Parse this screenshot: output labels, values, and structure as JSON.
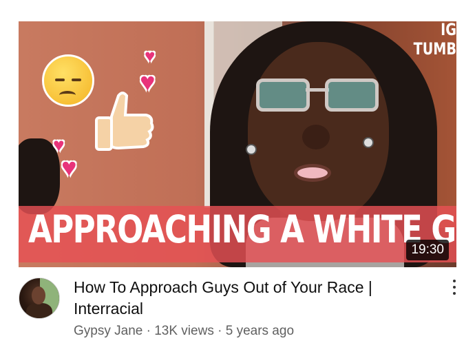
{
  "video": {
    "thumbnail_text": "APPROACHING A WHITE GUY",
    "watermark_line1": "IG",
    "watermark_line2": "TUMB",
    "duration": "19:30",
    "title": "How To Approach Guys Out of Your Race | Interracial",
    "channel": "Gypsy Jane",
    "views": "13K views",
    "age": "5 years ago",
    "separator": " · "
  },
  "icons": [
    "sad-face-emoji",
    "thumbs-up-emoji",
    "heart-emoji",
    "more-vert-icon",
    "avatar"
  ]
}
